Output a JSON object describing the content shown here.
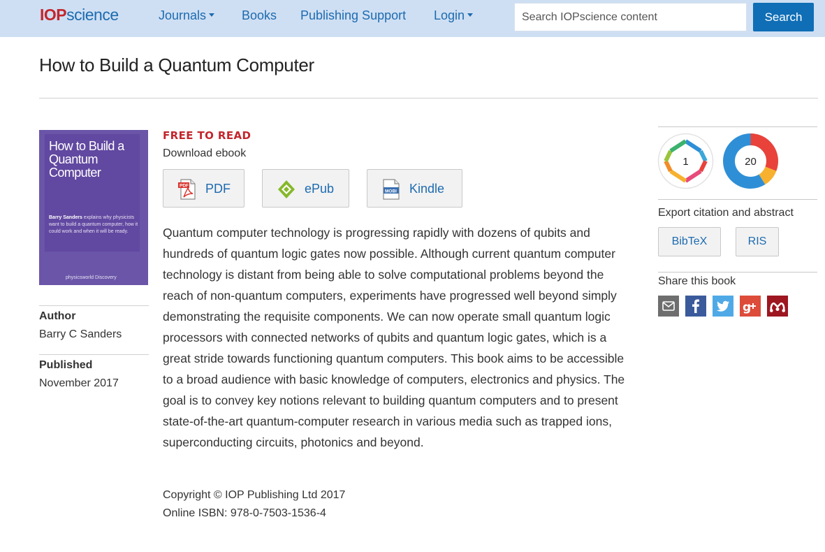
{
  "nav": {
    "logo_iop": "IOP",
    "logo_science": "science",
    "journals": "Journals",
    "books": "Books",
    "publishing_support": "Publishing Support",
    "login": "Login",
    "search_placeholder": "Search IOPscience content",
    "search_button": "Search"
  },
  "book": {
    "title": "How to Build a Quantum Computer",
    "cover": {
      "title": "How to Build a Quantum Computer",
      "blurb_author": "Barry Sanders",
      "blurb_text": " explains why physicists want to build a quantum computer, how it could work and when it will be ready.",
      "brand": "physicsworld Discovery"
    },
    "author_label": "Author",
    "author": "Barry C Sanders",
    "published_label": "Published",
    "published": "November 2017",
    "free_label": "FREE TO READ",
    "download_label": "Download ebook",
    "downloads": [
      {
        "label": "PDF",
        "icon": "pdf-icon"
      },
      {
        "label": "ePub",
        "icon": "epub-icon"
      },
      {
        "label": "Kindle",
        "icon": "mobi-icon"
      }
    ],
    "abstract": "Quantum computer technology is progressing rapidly with dozens of qubits and hundreds of quantum logic gates now possible. Although current quantum computer technology is distant from being able to solve computational problems beyond the reach of non-quantum computers, experiments have progressed well beyond simply demonstrating the requisite components. We can now operate small quantum logic processors with connected networks of qubits and quantum logic gates, which is a great stride towards functioning quantum computers. This book aims to be accessible to a broad audience with basic knowledge of computers, electronics and physics. The goal is to convey key notions relevant to building quantum computers and to present state-of-the-art quantum-computer research in various media such as trapped ions, superconducting circuits, photonics and beyond.",
    "copyright": "Copyright © IOP Publishing Ltd 2017",
    "isbn": "Online ISBN: 978-0-7503-1536-4"
  },
  "sidebar": {
    "metrics": [
      {
        "value": "1",
        "icon": "dimensions-badge-icon"
      },
      {
        "value": "20",
        "icon": "altmetric-donut-icon"
      }
    ],
    "export_label": "Export citation and abstract",
    "export_buttons": [
      "BibTeX",
      "RIS"
    ],
    "share_label": "Share this book",
    "share_icons": [
      "email-icon",
      "facebook-icon",
      "twitter-icon",
      "google-plus-icon",
      "mendeley-icon"
    ]
  },
  "colors": {
    "navbar_bg": "#cfdff3",
    "link": "#1d6bb0",
    "brand_red": "#c3262d",
    "search_button": "#0f6eb6",
    "cover_purple": "#6a55a8"
  }
}
